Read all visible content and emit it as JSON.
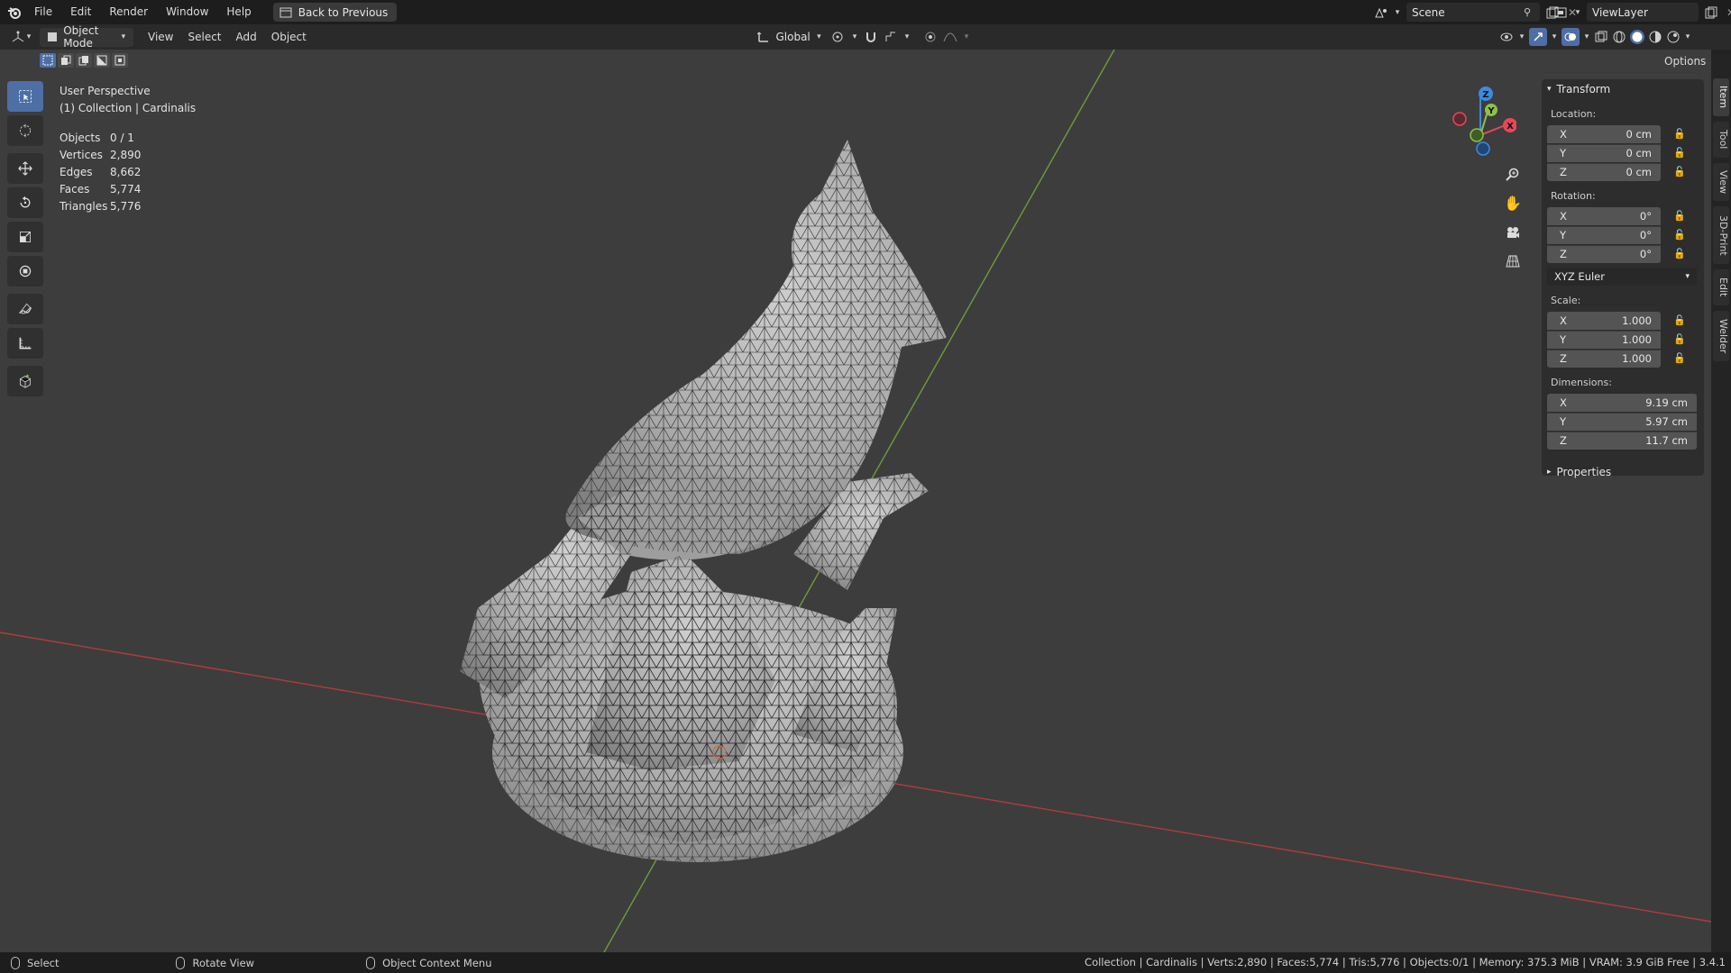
{
  "menu": {
    "items": [
      "File",
      "Edit",
      "Render",
      "Window",
      "Help"
    ],
    "back_button": "Back to Previous"
  },
  "scene": {
    "name": "Scene",
    "view_layer": "ViewLayer"
  },
  "header": {
    "mode": "Object Mode",
    "menus": [
      "View",
      "Select",
      "Add",
      "Object"
    ],
    "orientation": "Global",
    "options": "Options"
  },
  "viewport": {
    "perspective": "User Perspective",
    "collection": "(1) Collection | Cardinalis",
    "stats": [
      {
        "label": "Objects",
        "value": "0 / 1"
      },
      {
        "label": "Vertices",
        "value": "2,890"
      },
      {
        "label": "Edges",
        "value": "8,662"
      },
      {
        "label": "Faces",
        "value": "5,774"
      },
      {
        "label": "Triangles",
        "value": "5,776"
      }
    ],
    "gizmo": {
      "x": "X",
      "y": "Y",
      "z": "Z"
    }
  },
  "transform": {
    "title": "Transform",
    "location_label": "Location:",
    "location": [
      {
        "axis": "X",
        "value": "0 cm"
      },
      {
        "axis": "Y",
        "value": "0 cm"
      },
      {
        "axis": "Z",
        "value": "0 cm"
      }
    ],
    "rotation_label": "Rotation:",
    "rotation": [
      {
        "axis": "X",
        "value": "0°"
      },
      {
        "axis": "Y",
        "value": "0°"
      },
      {
        "axis": "Z",
        "value": "0°"
      }
    ],
    "rotation_mode": "XYZ Euler",
    "scale_label": "Scale:",
    "scale": [
      {
        "axis": "X",
        "value": "1.000"
      },
      {
        "axis": "Y",
        "value": "1.000"
      },
      {
        "axis": "Z",
        "value": "1.000"
      }
    ],
    "dimensions_label": "Dimensions:",
    "dimensions": [
      {
        "axis": "X",
        "value": "9.19 cm"
      },
      {
        "axis": "Y",
        "value": "5.97 cm"
      },
      {
        "axis": "Z",
        "value": "11.7 cm"
      }
    ]
  },
  "properties": {
    "title": "Properties"
  },
  "side_tabs": [
    "Item",
    "Tool",
    "View",
    "3D-Print",
    "Edit",
    "Welder"
  ],
  "status": {
    "select": "Select",
    "rotate": "Rotate View",
    "context": "Object Context Menu",
    "info": "Collection | Cardinalis | Verts:2,890 | Faces:5,774 | Tris:5,776 | Objects:0/1 | Memory: 375.3 MiB | VRAM: 3.9 GiB Free | 3.4.1"
  },
  "colors": {
    "accent": "#4d6fa6",
    "x_axis": "#e8475a",
    "y_axis": "#8bc34a",
    "z_axis": "#3b8be0",
    "grid_red": "#c8323c",
    "grid_green": "#7aa83a"
  }
}
